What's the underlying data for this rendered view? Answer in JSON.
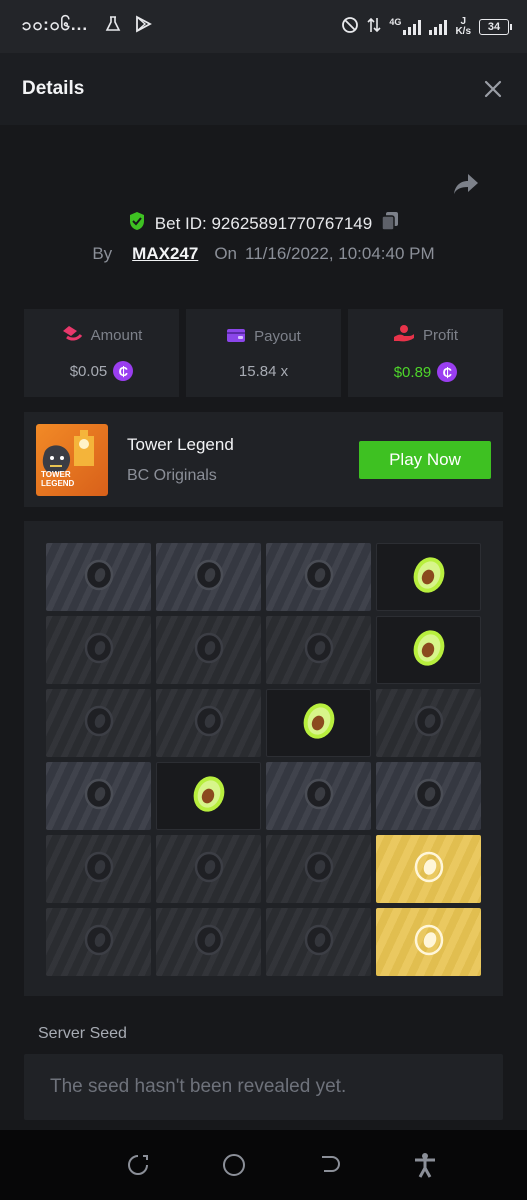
{
  "status_bar": {
    "time": "၁၀:၀၆...",
    "network": "4G",
    "speed_unit": "K/s",
    "speed_value": "J",
    "battery": "34"
  },
  "header": {
    "title": "Details"
  },
  "bet": {
    "id_text": "Bet ID: 92625891770767149",
    "by_label": "By",
    "user": "MAX247",
    "on_label": "On",
    "datetime": "11/16/2022, 10:04:40 PM"
  },
  "stats": {
    "amount_label": "Amount",
    "amount_value": "$0.05",
    "payout_label": "Payout",
    "payout_value": "15.84 x",
    "profit_label": "Profit",
    "profit_value": "$0.89",
    "coin_symbol": "₵"
  },
  "game": {
    "name": "Tower Legend",
    "provider": "BC Originals",
    "thumb_text_line1": "TOWER",
    "thumb_text_line2": "LEGEND",
    "play_label": "Play Now"
  },
  "board": {
    "rows": [
      [
        "hi",
        "hi",
        "hi",
        "gem"
      ],
      [
        "dim",
        "dim",
        "dim",
        "gem"
      ],
      [
        "dim",
        "dim",
        "gem",
        "dim"
      ],
      [
        "hi",
        "gem",
        "hi",
        "hi"
      ],
      [
        "dim",
        "dim",
        "dim",
        "gold"
      ],
      [
        "dim",
        "dim",
        "dim",
        "gold"
      ]
    ]
  },
  "server_seed": {
    "label": "Server Seed",
    "value": "The seed hasn't been revealed yet."
  },
  "colors": {
    "accent_green": "#3ec122",
    "coin_purple": "#9a3ef0",
    "gold_tile": "#e8c452",
    "profit_green": "#4ed62a"
  }
}
